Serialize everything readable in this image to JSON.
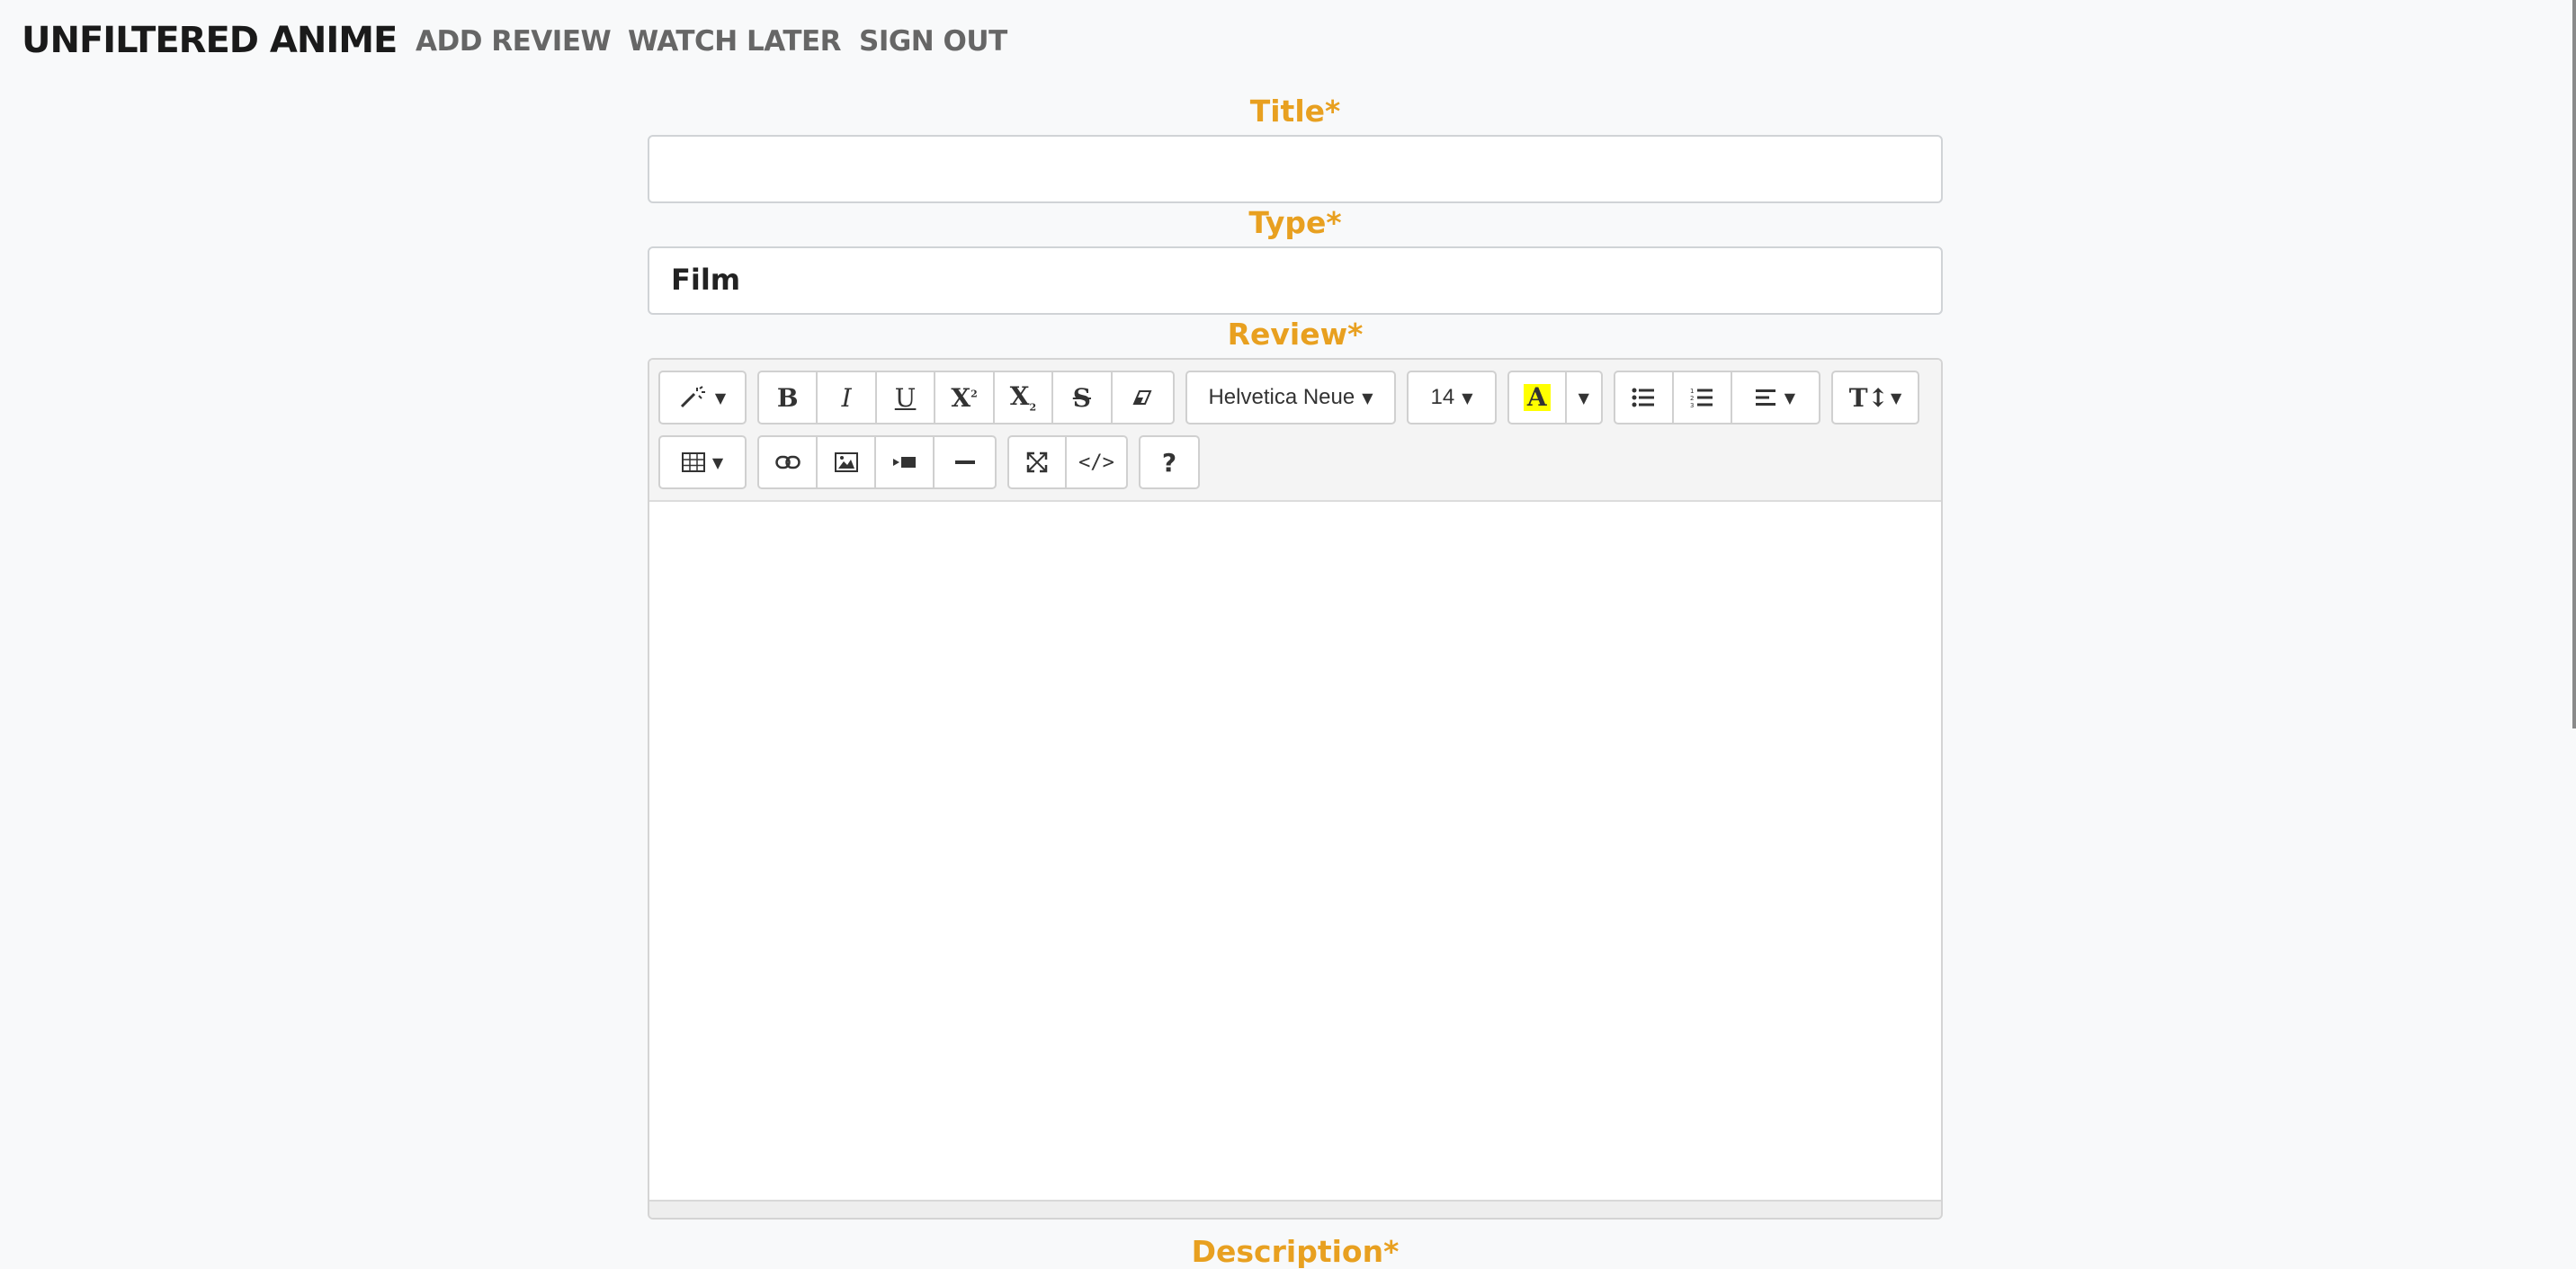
{
  "nav": {
    "brand": "UNFILTERED ANIME",
    "links": [
      "ADD REVIEW",
      "WATCH LATER",
      "SIGN OUT"
    ]
  },
  "form": {
    "title_label": "Title*",
    "title_value": "",
    "type_label": "Type*",
    "type_value": "Film",
    "review_label": "Review*",
    "description_label": "Description*"
  },
  "editor": {
    "font_name": "Helvetica Neue",
    "font_size": "14",
    "help_label": "?",
    "code_label": "</>",
    "highlight_color": "#ffff00"
  },
  "colors": {
    "accent": "#e8a020"
  }
}
